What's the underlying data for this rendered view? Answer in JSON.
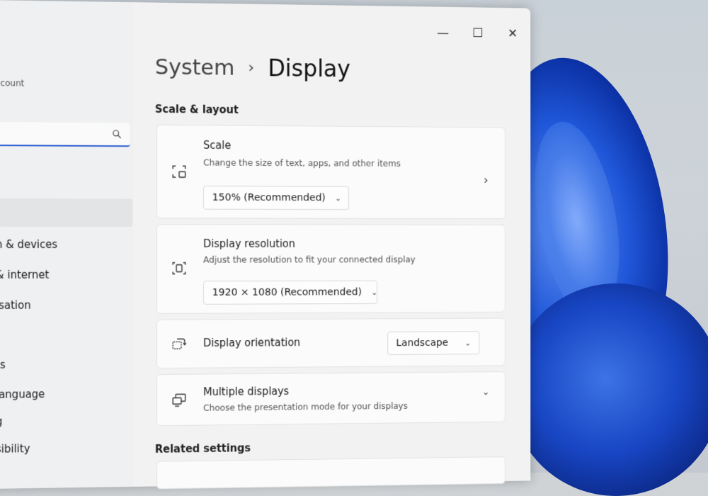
{
  "sidebar": {
    "account_label": "ccount",
    "search_placeholder": "",
    "items": [
      {
        "label": "n & devices"
      },
      {
        "label": "& internet"
      },
      {
        "label": "isation"
      },
      {
        "label": "ts"
      },
      {
        "label": "language"
      },
      {
        "label": "g"
      },
      {
        "label": "sibility"
      }
    ]
  },
  "window_controls": {
    "minimize": "—",
    "maximize": "☐",
    "close": "✕"
  },
  "breadcrumb": {
    "parent": "System",
    "separator": "›",
    "current": "Display"
  },
  "sections": {
    "scale_layout": "Scale & layout",
    "related": "Related settings"
  },
  "cards": {
    "scale": {
      "title": "Scale",
      "description": "Change the size of text, apps, and other items",
      "value": "150% (Recommended)"
    },
    "resolution": {
      "title": "Display resolution",
      "description": "Adjust the resolution to fit your connected display",
      "value": "1920 × 1080 (Recommended)"
    },
    "orientation": {
      "title": "Display orientation",
      "value": "Landscape"
    },
    "multiple": {
      "title": "Multiple displays",
      "description": "Choose the presentation mode for your displays"
    }
  },
  "colors": {
    "accent": "#2f5fd1",
    "window_bg": "#f2f2f3",
    "card_bg": "#fbfbfb"
  },
  "icons": {
    "search": "search-icon",
    "scale": "scale-icon",
    "resolution": "resolution-icon",
    "orientation": "orientation-icon",
    "multiple": "multiple-displays-icon"
  }
}
